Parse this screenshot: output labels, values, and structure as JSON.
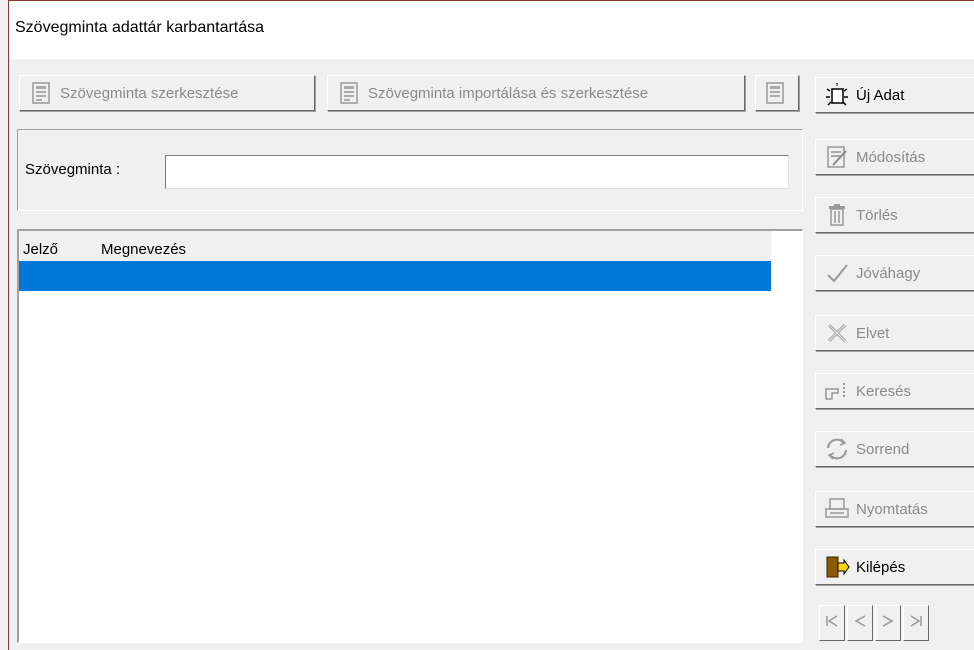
{
  "window": {
    "title": "Szövegminta adattár karbantartása"
  },
  "toolbar": {
    "edit_label": "Szövegminta szerkesztése",
    "import_label": "Szövegminta importálása és szerkesztése"
  },
  "form": {
    "pattern_label": "Szövegminta :",
    "pattern_value": ""
  },
  "list": {
    "columns": [
      "Jelző",
      "Megnevezés"
    ],
    "rows": []
  },
  "actions": {
    "new": "Új Adat",
    "modify": "Módosítás",
    "delete": "Törlés",
    "approve": "Jóváhagy",
    "reject": "Elvet",
    "search": "Keresés",
    "order": "Sorrend",
    "print": "Nyomtatás",
    "exit": "Kilépés"
  },
  "colors": {
    "selection": "#0078d7",
    "disabled_text": "#8a8a8a",
    "window_border": "#8a3a32"
  },
  "icons": {
    "edit": "document-edit-icon",
    "import": "document-import-icon",
    "extra": "document-icon",
    "new": "new-document-icon",
    "modify": "document-modify-icon",
    "delete": "trash-icon",
    "approve": "checkmark-icon",
    "reject": "x-icon",
    "search": "pointing-hand-icon",
    "order": "refresh-icon",
    "print": "printer-icon",
    "exit": "exit-door-icon",
    "nav_first": "first-record-icon",
    "nav_prev": "prev-record-icon",
    "nav_next": "next-record-icon",
    "nav_last": "last-record-icon"
  }
}
